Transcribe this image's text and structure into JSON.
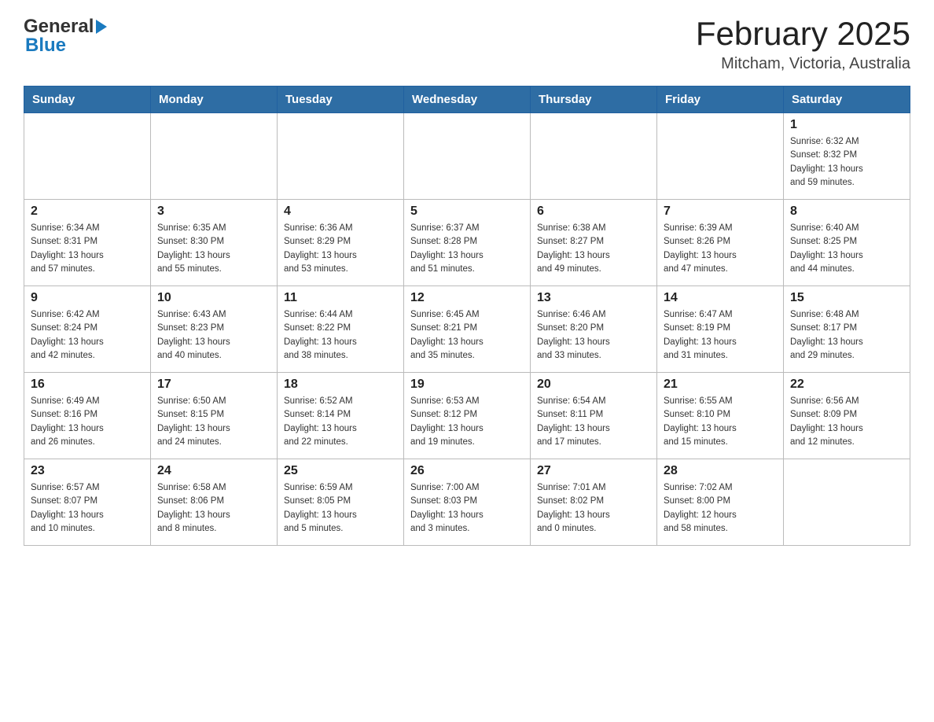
{
  "header": {
    "logo_general": "General",
    "logo_blue": "Blue",
    "title": "February 2025",
    "subtitle": "Mitcham, Victoria, Australia"
  },
  "days_of_week": [
    "Sunday",
    "Monday",
    "Tuesday",
    "Wednesday",
    "Thursday",
    "Friday",
    "Saturday"
  ],
  "weeks": [
    [
      {
        "day": "",
        "info": ""
      },
      {
        "day": "",
        "info": ""
      },
      {
        "day": "",
        "info": ""
      },
      {
        "day": "",
        "info": ""
      },
      {
        "day": "",
        "info": ""
      },
      {
        "day": "",
        "info": ""
      },
      {
        "day": "1",
        "info": "Sunrise: 6:32 AM\nSunset: 8:32 PM\nDaylight: 13 hours\nand 59 minutes."
      }
    ],
    [
      {
        "day": "2",
        "info": "Sunrise: 6:34 AM\nSunset: 8:31 PM\nDaylight: 13 hours\nand 57 minutes."
      },
      {
        "day": "3",
        "info": "Sunrise: 6:35 AM\nSunset: 8:30 PM\nDaylight: 13 hours\nand 55 minutes."
      },
      {
        "day": "4",
        "info": "Sunrise: 6:36 AM\nSunset: 8:29 PM\nDaylight: 13 hours\nand 53 minutes."
      },
      {
        "day": "5",
        "info": "Sunrise: 6:37 AM\nSunset: 8:28 PM\nDaylight: 13 hours\nand 51 minutes."
      },
      {
        "day": "6",
        "info": "Sunrise: 6:38 AM\nSunset: 8:27 PM\nDaylight: 13 hours\nand 49 minutes."
      },
      {
        "day": "7",
        "info": "Sunrise: 6:39 AM\nSunset: 8:26 PM\nDaylight: 13 hours\nand 47 minutes."
      },
      {
        "day": "8",
        "info": "Sunrise: 6:40 AM\nSunset: 8:25 PM\nDaylight: 13 hours\nand 44 minutes."
      }
    ],
    [
      {
        "day": "9",
        "info": "Sunrise: 6:42 AM\nSunset: 8:24 PM\nDaylight: 13 hours\nand 42 minutes."
      },
      {
        "day": "10",
        "info": "Sunrise: 6:43 AM\nSunset: 8:23 PM\nDaylight: 13 hours\nand 40 minutes."
      },
      {
        "day": "11",
        "info": "Sunrise: 6:44 AM\nSunset: 8:22 PM\nDaylight: 13 hours\nand 38 minutes."
      },
      {
        "day": "12",
        "info": "Sunrise: 6:45 AM\nSunset: 8:21 PM\nDaylight: 13 hours\nand 35 minutes."
      },
      {
        "day": "13",
        "info": "Sunrise: 6:46 AM\nSunset: 8:20 PM\nDaylight: 13 hours\nand 33 minutes."
      },
      {
        "day": "14",
        "info": "Sunrise: 6:47 AM\nSunset: 8:19 PM\nDaylight: 13 hours\nand 31 minutes."
      },
      {
        "day": "15",
        "info": "Sunrise: 6:48 AM\nSunset: 8:17 PM\nDaylight: 13 hours\nand 29 minutes."
      }
    ],
    [
      {
        "day": "16",
        "info": "Sunrise: 6:49 AM\nSunset: 8:16 PM\nDaylight: 13 hours\nand 26 minutes."
      },
      {
        "day": "17",
        "info": "Sunrise: 6:50 AM\nSunset: 8:15 PM\nDaylight: 13 hours\nand 24 minutes."
      },
      {
        "day": "18",
        "info": "Sunrise: 6:52 AM\nSunset: 8:14 PM\nDaylight: 13 hours\nand 22 minutes."
      },
      {
        "day": "19",
        "info": "Sunrise: 6:53 AM\nSunset: 8:12 PM\nDaylight: 13 hours\nand 19 minutes."
      },
      {
        "day": "20",
        "info": "Sunrise: 6:54 AM\nSunset: 8:11 PM\nDaylight: 13 hours\nand 17 minutes."
      },
      {
        "day": "21",
        "info": "Sunrise: 6:55 AM\nSunset: 8:10 PM\nDaylight: 13 hours\nand 15 minutes."
      },
      {
        "day": "22",
        "info": "Sunrise: 6:56 AM\nSunset: 8:09 PM\nDaylight: 13 hours\nand 12 minutes."
      }
    ],
    [
      {
        "day": "23",
        "info": "Sunrise: 6:57 AM\nSunset: 8:07 PM\nDaylight: 13 hours\nand 10 minutes."
      },
      {
        "day": "24",
        "info": "Sunrise: 6:58 AM\nSunset: 8:06 PM\nDaylight: 13 hours\nand 8 minutes."
      },
      {
        "day": "25",
        "info": "Sunrise: 6:59 AM\nSunset: 8:05 PM\nDaylight: 13 hours\nand 5 minutes."
      },
      {
        "day": "26",
        "info": "Sunrise: 7:00 AM\nSunset: 8:03 PM\nDaylight: 13 hours\nand 3 minutes."
      },
      {
        "day": "27",
        "info": "Sunrise: 7:01 AM\nSunset: 8:02 PM\nDaylight: 13 hours\nand 0 minutes."
      },
      {
        "day": "28",
        "info": "Sunrise: 7:02 AM\nSunset: 8:00 PM\nDaylight: 12 hours\nand 58 minutes."
      },
      {
        "day": "",
        "info": ""
      }
    ]
  ]
}
